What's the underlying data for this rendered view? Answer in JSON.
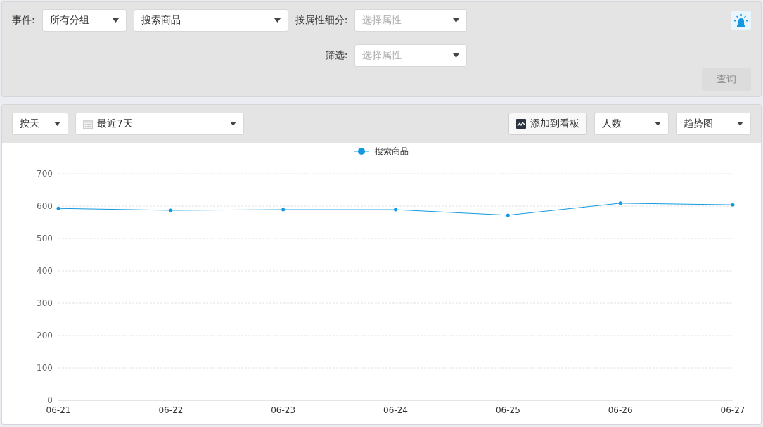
{
  "filter_panel": {
    "event_label": "事件:",
    "event_group": {
      "value": "所有分组"
    },
    "event": {
      "value": "搜索商品"
    },
    "breakdown_label": "按属性细分:",
    "breakdown": {
      "placeholder": "选择属性"
    },
    "filter_label": "筛选:",
    "filter": {
      "placeholder": "选择属性"
    },
    "query_button": {
      "label": "查询",
      "disabled": true
    }
  },
  "toolbar": {
    "granularity": {
      "value": "按天"
    },
    "date_range": {
      "value": "最近7天"
    },
    "add_to_dashboard": "添加到看板",
    "metric": {
      "value": "人数"
    },
    "chart_type": {
      "value": "趋势图"
    }
  },
  "chart_data": {
    "type": "line",
    "categories": [
      "06-21",
      "06-22",
      "06-23",
      "06-24",
      "06-25",
      "06-26",
      "06-27"
    ],
    "series": [
      {
        "name": "搜索商品",
        "color": "#1499e0",
        "values": [
          593,
          587,
          589,
          589,
          572,
          609,
          604
        ]
      }
    ],
    "grid": true,
    "ylim": [
      0,
      700
    ],
    "yticks": [
      0,
      100,
      200,
      300,
      400,
      500,
      600,
      700
    ]
  }
}
